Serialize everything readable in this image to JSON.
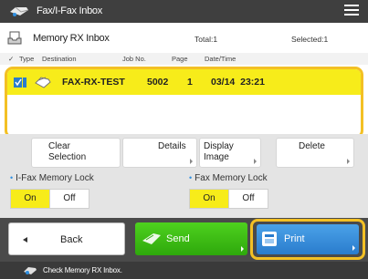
{
  "window": {
    "title": "Fax/I-Fax Inbox",
    "menu_icon": "hamburger-menu-icon"
  },
  "header": {
    "inbox_name": "Memory RX Inbox",
    "total": "Total:1",
    "selected": "Selected:1"
  },
  "columns": {
    "check": "✓",
    "type": "Type",
    "destination": "Destination",
    "job_no": "Job No.",
    "page": "Page",
    "date_time": "Date/Time"
  },
  "jobs": [
    {
      "destination": "FAX-RX-TEST",
      "job_no": "5002",
      "page": "1",
      "date_time": "03/14  23:21",
      "selected": true
    }
  ],
  "actions": {
    "clear_selection": "Clear\nSelection",
    "details": "Details",
    "display_image": "Display\nImage",
    "delete": "Delete"
  },
  "locks": {
    "ifax": {
      "label": "I-Fax Memory Lock",
      "on": "On",
      "off": "Off",
      "active": "On"
    },
    "fax": {
      "label": "Fax Memory Lock",
      "on": "On",
      "off": "Off",
      "active": "On"
    }
  },
  "bottom": {
    "back": "Back",
    "send": "Send",
    "print": "Print"
  },
  "status": {
    "message": "Check Memory RX Inbox."
  },
  "colors": {
    "highlight": "#f7ec1a",
    "focus_ring": "#f3c024",
    "send": "#3cbf14",
    "print": "#3a8ede",
    "title_bar": "#3f3f3f"
  }
}
